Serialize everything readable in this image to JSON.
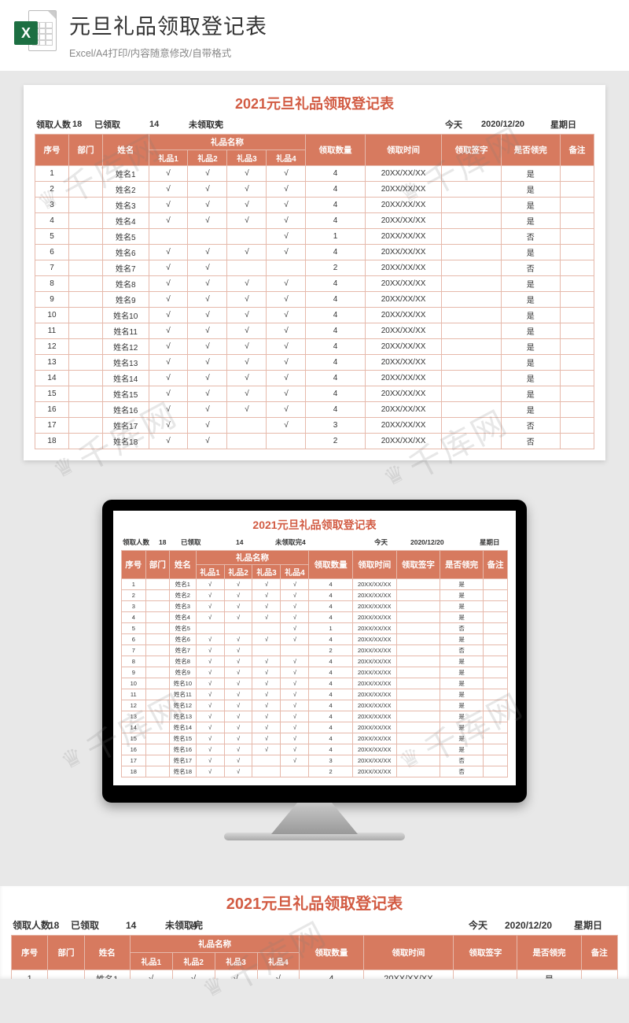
{
  "header": {
    "title": "元旦礼品领取登记表",
    "subtitle": "Excel/A4打印/内容随意修改/自带格式",
    "excel_icon_letter": "X"
  },
  "watermark_text": "千库网",
  "sheet": {
    "title": "2021元旦礼品领取登记表",
    "summary": {
      "label_total": "领取人数",
      "val_total": "18",
      "label_done": "已领取",
      "val_done": "14",
      "label_pending": "未领取完",
      "val_pending": "4",
      "label_today": "今天",
      "val_today": "2020/12/20",
      "label_weekday": "星期日"
    },
    "columns": {
      "seq": "序号",
      "dept": "部门",
      "name": "姓名",
      "gift_group": "礼品名称",
      "gift1": "礼品1",
      "gift2": "礼品2",
      "gift3": "礼品3",
      "gift4": "礼品4",
      "qty": "领取数量",
      "time": "领取时间",
      "sign": "领取签字",
      "done": "是否领完",
      "note": "备注"
    },
    "rows": [
      {
        "seq": "1",
        "name": "姓名1",
        "g1": "√",
        "g2": "√",
        "g3": "√",
        "g4": "√",
        "qty": "4",
        "time": "20XX/XX/XX",
        "done": "是"
      },
      {
        "seq": "2",
        "name": "姓名2",
        "g1": "√",
        "g2": "√",
        "g3": "√",
        "g4": "√",
        "qty": "4",
        "time": "20XX/XX/XX",
        "done": "是"
      },
      {
        "seq": "3",
        "name": "姓名3",
        "g1": "√",
        "g2": "√",
        "g3": "√",
        "g4": "√",
        "qty": "4",
        "time": "20XX/XX/XX",
        "done": "是"
      },
      {
        "seq": "4",
        "name": "姓名4",
        "g1": "√",
        "g2": "√",
        "g3": "√",
        "g4": "√",
        "qty": "4",
        "time": "20XX/XX/XX",
        "done": "是"
      },
      {
        "seq": "5",
        "name": "姓名5",
        "g1": "",
        "g2": "",
        "g3": "",
        "g4": "√",
        "qty": "1",
        "time": "20XX/XX/XX",
        "done": "否"
      },
      {
        "seq": "6",
        "name": "姓名6",
        "g1": "√",
        "g2": "√",
        "g3": "√",
        "g4": "√",
        "qty": "4",
        "time": "20XX/XX/XX",
        "done": "是"
      },
      {
        "seq": "7",
        "name": "姓名7",
        "g1": "√",
        "g2": "√",
        "g3": "",
        "g4": "",
        "qty": "2",
        "time": "20XX/XX/XX",
        "done": "否"
      },
      {
        "seq": "8",
        "name": "姓名8",
        "g1": "√",
        "g2": "√",
        "g3": "√",
        "g4": "√",
        "qty": "4",
        "time": "20XX/XX/XX",
        "done": "是"
      },
      {
        "seq": "9",
        "name": "姓名9",
        "g1": "√",
        "g2": "√",
        "g3": "√",
        "g4": "√",
        "qty": "4",
        "time": "20XX/XX/XX",
        "done": "是"
      },
      {
        "seq": "10",
        "name": "姓名10",
        "g1": "√",
        "g2": "√",
        "g3": "√",
        "g4": "√",
        "qty": "4",
        "time": "20XX/XX/XX",
        "done": "是"
      },
      {
        "seq": "11",
        "name": "姓名11",
        "g1": "√",
        "g2": "√",
        "g3": "√",
        "g4": "√",
        "qty": "4",
        "time": "20XX/XX/XX",
        "done": "是"
      },
      {
        "seq": "12",
        "name": "姓名12",
        "g1": "√",
        "g2": "√",
        "g3": "√",
        "g4": "√",
        "qty": "4",
        "time": "20XX/XX/XX",
        "done": "是"
      },
      {
        "seq": "13",
        "name": "姓名13",
        "g1": "√",
        "g2": "√",
        "g3": "√",
        "g4": "√",
        "qty": "4",
        "time": "20XX/XX/XX",
        "done": "是"
      },
      {
        "seq": "14",
        "name": "姓名14",
        "g1": "√",
        "g2": "√",
        "g3": "√",
        "g4": "√",
        "qty": "4",
        "time": "20XX/XX/XX",
        "done": "是"
      },
      {
        "seq": "15",
        "name": "姓名15",
        "g1": "√",
        "g2": "√",
        "g3": "√",
        "g4": "√",
        "qty": "4",
        "time": "20XX/XX/XX",
        "done": "是"
      },
      {
        "seq": "16",
        "name": "姓名16",
        "g1": "√",
        "g2": "√",
        "g3": "√",
        "g4": "√",
        "qty": "4",
        "time": "20XX/XX/XX",
        "done": "是"
      },
      {
        "seq": "17",
        "name": "姓名17",
        "g1": "√",
        "g2": "√",
        "g3": "",
        "g4": "√",
        "qty": "3",
        "time": "20XX/XX/XX",
        "done": "否"
      },
      {
        "seq": "18",
        "name": "姓名18",
        "g1": "√",
        "g2": "√",
        "g3": "",
        "g4": "",
        "qty": "2",
        "time": "20XX/XX/XX",
        "done": "否"
      }
    ]
  }
}
